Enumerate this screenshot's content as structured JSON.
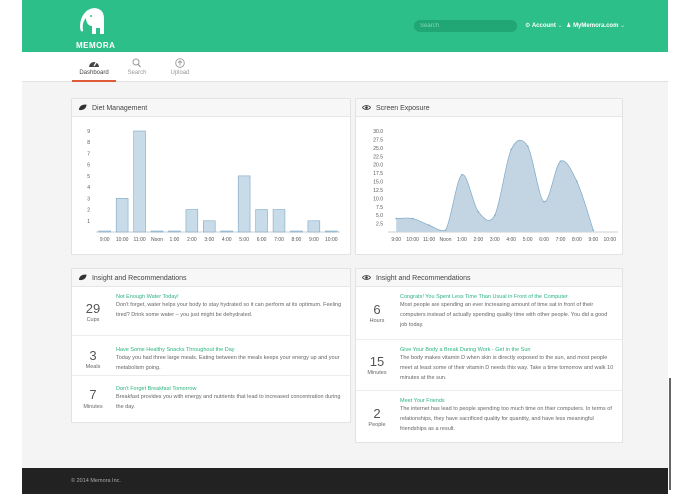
{
  "brand": {
    "name": "MEMORA"
  },
  "search": {
    "placeholder": "Search"
  },
  "topnav": {
    "account": "Account",
    "site": "MyMemora.com"
  },
  "tabs": [
    {
      "label": "Dashboard",
      "icon": "dashboard-icon",
      "active": true
    },
    {
      "label": "Search",
      "icon": "search-icon",
      "active": false
    },
    {
      "label": "Upload",
      "icon": "upload-icon",
      "active": false
    }
  ],
  "colors": {
    "brand": "#2dbf8a",
    "accent_tab": "#e05a3a",
    "bar_fill": "#c8dbe8",
    "bar_stroke": "#7fa9c6",
    "area_fill": "#c3d5e3",
    "insight_title": "#2db37f"
  },
  "panels": {
    "diet": {
      "title": "Diet Management",
      "icon": "leaf-icon"
    },
    "screen": {
      "title": "Screen Exposure",
      "icon": "eye-icon"
    },
    "diet_insights": {
      "title": "Insight and Recommendations",
      "icon": "leaf-icon"
    },
    "screen_insights": {
      "title": "Insight and Recommendations",
      "icon": "eye-icon"
    }
  },
  "chart_data": [
    {
      "type": "bar",
      "categories": [
        "9:00",
        "10:00",
        "11:00",
        "Noon",
        "1:00",
        "2:00",
        "3:00",
        "4:00",
        "5:00",
        "6:00",
        "7:00",
        "8:00",
        "9:00",
        "10:00"
      ],
      "values": [
        0,
        3,
        9,
        0,
        0,
        2,
        1,
        0,
        5,
        2,
        2,
        0,
        1,
        0
      ],
      "ylim": [
        0,
        9
      ],
      "yticks": [
        1,
        2,
        3,
        4,
        5,
        6,
        7,
        8,
        9
      ],
      "grid": false
    },
    {
      "type": "area",
      "x": [
        "9:00",
        "10:00",
        "11:00",
        "Noon",
        "1:00",
        "2:00",
        "3:00",
        "4:00",
        "5:00",
        "6:00",
        "7:00",
        "8:00",
        "9:00",
        "10:00"
      ],
      "values": [
        4,
        4,
        2,
        0.5,
        17,
        6,
        5,
        24.5,
        25.5,
        9,
        21,
        15,
        0.5,
        null
      ],
      "ylim": [
        0,
        30
      ],
      "yticks": [
        "2.5",
        "5.0",
        "7.5",
        "10.0",
        "12.5",
        "15.0",
        "17.5",
        "20.0",
        "22.5",
        "25.0",
        "27.5",
        "30.0"
      ],
      "grid": false
    }
  ],
  "diet_insights": [
    {
      "value": "29",
      "unit": "Cups",
      "title": "Not Enough Water Today!",
      "body": "Don't forget, water helps your body to stay hydrated so it can perform at its optimum. Feeling tired? Drink some water – you just might be dehydrated."
    },
    {
      "value": "3",
      "unit": "Meals",
      "title": "Have Some Healthy Snacks Throughout the Day",
      "body": "Today you had three large meals. Eating between the meals keeps your energy up and your metabolism going."
    },
    {
      "value": "7",
      "unit": "Minutes",
      "title": "Don't Forget Breakfast Tomorrow",
      "body": "Breakfast provides you with energy and nutrients that lead to increased concentration during the day."
    }
  ],
  "screen_insights": [
    {
      "value": "6",
      "unit": "Hours",
      "title": "Congrats! You Spent Less Time Than Usual in Front of the Computer",
      "body": "Most people are spending an ever increasing amount of time sat in front of their computers instead of actually spending quality time with other people. You did a good job today."
    },
    {
      "value": "15",
      "unit": "Minutes",
      "title": "Give Your Body a Break During Work - Get in the Sun",
      "body": "The body makes vitamin D when skin is directly exposed to the sun, and most people meet at least some of their vitamin D needs this way. Take a time tomorrow and walk 10 minutes at the sun."
    },
    {
      "value": "2",
      "unit": "People",
      "title": "Meet Your Friends",
      "body": "The internet has lead to people spending too much time on thier computers. In terms of relationships, they have sacrificed quality for quantity, and have less meaningful friendships as a result."
    }
  ],
  "footer": {
    "copyright": "© 2014 Memora Inc."
  }
}
